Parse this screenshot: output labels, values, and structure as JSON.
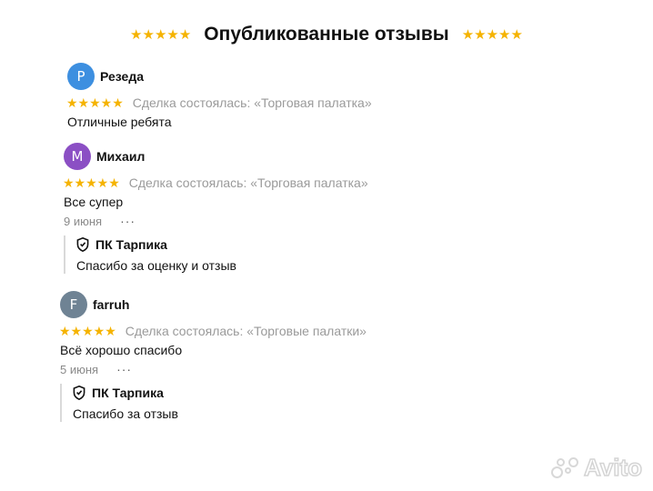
{
  "header": {
    "title": "Опубликованные отзывы",
    "stars_left": "★★★★★",
    "stars_right": "★★★★★"
  },
  "colors": {
    "star": "#f5b300",
    "avatar_p": "#3d8fe0",
    "avatar_m": "#8b4fc4",
    "avatar_f": "#6f8394",
    "muted_text": "#9a9a9a"
  },
  "reviews": [
    {
      "avatar_letter": "Р",
      "author": "Резеда",
      "rating": 5,
      "stars": "★★★★★",
      "deal": "Сделка состоялась: «Торговая палатка»",
      "text": "Отличные ребята"
    },
    {
      "avatar_letter": "М",
      "author": "Михаил",
      "rating": 5,
      "stars": "★★★★★",
      "deal": "Сделка состоялась: «Торговая палатка»",
      "text": "Все супер",
      "date": "9 июня",
      "more": "···",
      "reply": {
        "seller": "ПК Тарпика",
        "text": "Спасибо за оценку и отзыв"
      }
    },
    {
      "avatar_letter": "F",
      "author": "farruh",
      "rating": 5,
      "stars": "★★★★★",
      "deal": "Сделка состоялась: «Торговые палатки»",
      "text": "Всё хорошо спасибо",
      "date": "5 июня",
      "more": "···",
      "reply": {
        "seller": "ПК Тарпика",
        "text": "Спасибо за отзыв"
      }
    }
  ],
  "watermark": {
    "text": "Avito"
  }
}
